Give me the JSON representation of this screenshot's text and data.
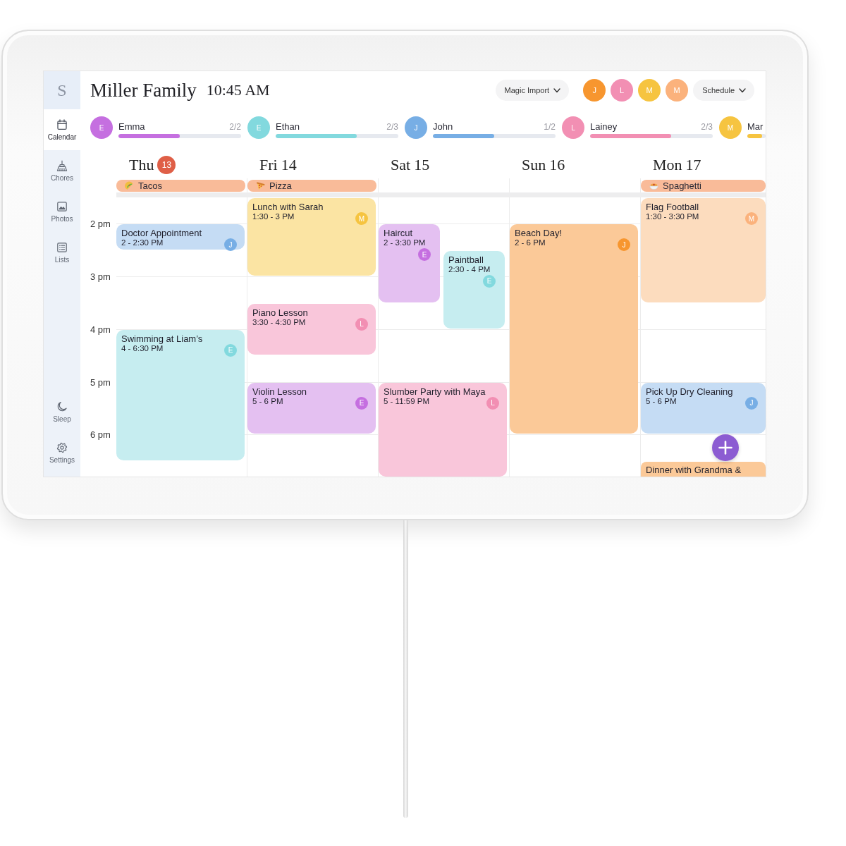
{
  "sidebar": {
    "logo": "S",
    "items": [
      {
        "kind": "calendar",
        "label": "Calendar",
        "selected": true
      },
      {
        "kind": "chores",
        "label": "Chores",
        "selected": false
      },
      {
        "kind": "photos",
        "label": "Photos",
        "selected": false
      },
      {
        "kind": "lists",
        "label": "Lists",
        "selected": false
      }
    ],
    "bottom_items": [
      {
        "kind": "sleep",
        "label": "Sleep",
        "selected": false
      },
      {
        "kind": "settings",
        "label": "Settings",
        "selected": false
      }
    ]
  },
  "header": {
    "title": "Miller Family",
    "time": "10:45 AM",
    "import_menu": {
      "label": "Magic Import"
    },
    "profiles": [
      {
        "initial": "J",
        "color": "#f7962f"
      },
      {
        "initial": "L",
        "color": "#f28fb3"
      },
      {
        "initial": "M",
        "color": "#f6c440"
      },
      {
        "initial": "M",
        "color": "#fbb27c"
      }
    ],
    "view_menu": {
      "label": "Schedule"
    }
  },
  "members": [
    {
      "initial": "E",
      "name": "Emma",
      "count": "2/2",
      "color": "#c56fe0",
      "level": 0.5
    },
    {
      "initial": "E",
      "name": "Ethan",
      "count": "2/3",
      "color": "#82d9de",
      "level": 0.66
    },
    {
      "initial": "J",
      "name": "John",
      "count": "1/2",
      "color": "#77aee5",
      "level": 0.5
    },
    {
      "initial": "L",
      "name": "Lainey",
      "count": "2/3",
      "color": "#f28fb3",
      "level": 0.66
    },
    {
      "initial": "M",
      "name": "Mar",
      "color": "#f6c440",
      "level": 0.8
    }
  ],
  "time_labels": [
    "2 pm",
    "3 pm",
    "4 pm",
    "5 pm",
    "6 pm"
  ],
  "days": [
    {
      "name": "Thu",
      "date": "13",
      "today": true,
      "meal": {
        "kind": "taco",
        "name": "Tacos"
      },
      "events": [
        {
          "title": "Doctor Appointment",
          "time": "2 - 2:30 PM",
          "color": "#c5dcf4",
          "avatar": {
            "initial": "J",
            "color": "#77aee5"
          }
        },
        {
          "title": "Swimming at Liam’s",
          "time": "4 - 6:30 PM",
          "color": "#c6edf0",
          "avatar": {
            "initial": "E",
            "color": "#82d9de"
          }
        }
      ]
    },
    {
      "name": "Fri",
      "date": "14",
      "today": false,
      "meal": {
        "kind": "pizza",
        "name": "Pizza"
      },
      "events": [
        {
          "title": "Lunch with Sarah",
          "time": "1:30 - 3 PM",
          "color": "#fbe4a3",
          "avatar": {
            "initial": "M",
            "color": "#f6c440"
          }
        },
        {
          "title": "Piano Lesson",
          "time": "3:30 - 4:30 PM",
          "color": "#f9c6da",
          "avatar": {
            "initial": "L",
            "color": "#f28fb3"
          }
        },
        {
          "title": "Violin Lesson",
          "time": "5 - 6 PM",
          "color": "#e4c0f1",
          "avatar": {
            "initial": "E",
            "color": "#c56fe0"
          }
        }
      ]
    },
    {
      "name": "Sat",
      "date": "15",
      "today": false,
      "events": [
        {
          "title": "Haircut",
          "time": "2 - 3:30 PM",
          "color": "#e4c0f1",
          "avatar": {
            "initial": "E",
            "color": "#c56fe0"
          }
        },
        {
          "title": "Paintball",
          "time": "2:30 - 4 PM",
          "color": "#c6edf0",
          "avatar": {
            "initial": "E",
            "color": "#82d9de"
          }
        },
        {
          "title": "Slumber Party with Maya",
          "time": "5 - 11:59 PM",
          "color": "#f9c6da",
          "avatar": {
            "initial": "L",
            "color": "#f28fb3"
          }
        }
      ]
    },
    {
      "name": "Sun",
      "date": "16",
      "today": false,
      "events": [
        {
          "title": "Beach Day!",
          "time": "2 - 6 PM",
          "color": "#fbc998",
          "avatar": {
            "initial": "J",
            "color": "#f7962f"
          }
        }
      ]
    },
    {
      "name": "Mon",
      "date": "17",
      "today": false,
      "meal": {
        "kind": "pasta",
        "name": "Spaghetti"
      },
      "events": [
        {
          "title": "Flag Football",
          "time": "1:30 - 3:30 PM",
          "color": "#fcdcbe",
          "avatar": {
            "initial": "M",
            "color": "#fbb27c"
          }
        },
        {
          "title": "Pick Up Dry Cleaning",
          "time": "5 - 6 PM",
          "color": "#c5dcf4",
          "avatar": {
            "initial": "J",
            "color": "#77aee5"
          }
        },
        {
          "title": "Dinner with Grandma &",
          "cut_off": true,
          "color": "#fbc998"
        }
      ]
    }
  ]
}
